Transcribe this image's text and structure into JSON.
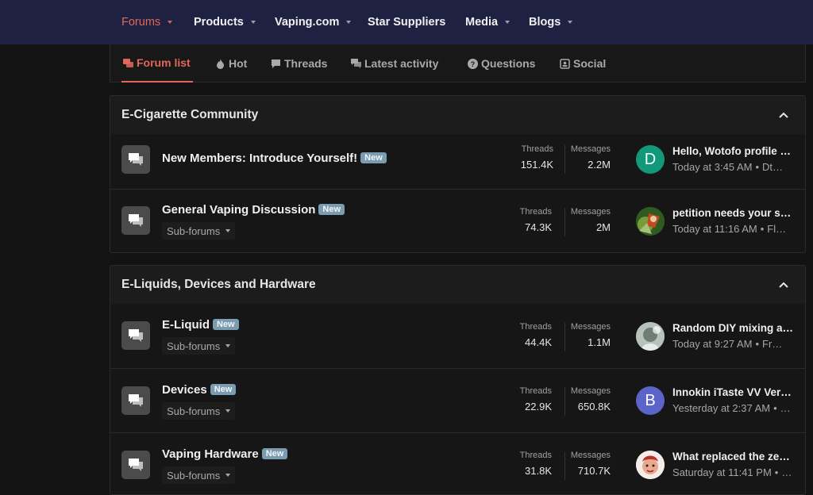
{
  "topnav": {
    "items": [
      {
        "label": "Forums"
      },
      {
        "label": "Products"
      },
      {
        "label": "Vaping.com"
      },
      {
        "label": "Star Suppliers"
      },
      {
        "label": "Media"
      },
      {
        "label": "Blogs"
      }
    ]
  },
  "tabs": [
    {
      "label": "Forum list"
    },
    {
      "label": "Hot"
    },
    {
      "label": "Threads"
    },
    {
      "label": "Latest activity"
    },
    {
      "label": "Questions"
    },
    {
      "label": "Social"
    }
  ],
  "categories": [
    {
      "title": "E-Cigarette Community",
      "nodes": [
        {
          "title": "New Members: Introduce Yourself!",
          "badge": "New",
          "threads_label": "Threads",
          "threads": "151.4K",
          "messages_label": "Messages",
          "messages": "2.2M",
          "avatar_letter": "D",
          "last_title": "Hello, Wotofo profile …",
          "last_time": "Today at 3:45 AM",
          "last_user": "Dt…"
        },
        {
          "title": "General Vaping Discussion",
          "badge": "New",
          "subforums": "Sub-forums",
          "threads_label": "Threads",
          "threads": "74.3K",
          "messages_label": "Messages",
          "messages": "2M",
          "last_title": "petition needs your s…",
          "last_time": "Today at 11:16 AM",
          "last_user": "Fl…"
        }
      ]
    },
    {
      "title": "E-Liquids, Devices and Hardware",
      "nodes": [
        {
          "title": "E-Liquid",
          "badge": "New",
          "subforums": "Sub-forums",
          "threads_label": "Threads",
          "threads": "44.4K",
          "messages_label": "Messages",
          "messages": "1.1M",
          "last_title": "Random DIY mixing a…",
          "last_time": "Today at 9:27 AM",
          "last_user": "Fr…"
        },
        {
          "title": "Devices",
          "badge": "New",
          "subforums": "Sub-forums",
          "threads_label": "Threads",
          "threads": "22.9K",
          "messages_label": "Messages",
          "messages": "650.8K",
          "avatar_letter": "B",
          "last_title": "Innokin iTaste VV Ver…",
          "last_time": "Yesterday at 2:37 AM",
          "last_user": "…"
        },
        {
          "title": "Vaping Hardware",
          "badge": "New",
          "subforums": "Sub-forums",
          "threads_label": "Threads",
          "threads": "31.8K",
          "messages_label": "Messages",
          "messages": "710.7K",
          "last_title": "What replaced the ze…",
          "last_time": "Saturday at 11:41 PM",
          "last_user": "…"
        }
      ]
    }
  ],
  "colors": {
    "accent": "#e0675a",
    "navbar": "#1f2142",
    "badge": "#7a9bb0",
    "avatar_d": "#12997a",
    "avatar_b": "#5b64c8"
  }
}
